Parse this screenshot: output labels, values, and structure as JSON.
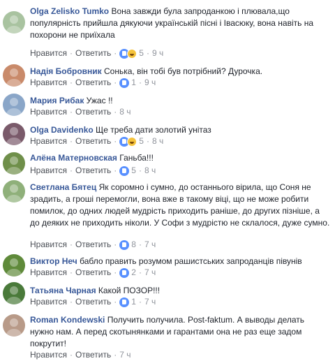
{
  "comments": [
    {
      "author": "Olga Zelisko Tumko",
      "text": "Вона завжди була запроданкою і плювала,що популярність прийшла дякуючи українській пісні і Івасюку, вона навіть на похорони не приїхала",
      "like": "Нравится",
      "reply": "Ответить",
      "reactions": [
        "like",
        "haha"
      ],
      "count": "5",
      "time": "9 ч",
      "avatar_color": "#a9c3a0"
    },
    {
      "author": "Надія Бобровник",
      "text": "Сонька, він тобі був потрібний? Дурочка.",
      "like": "Нравится",
      "reply": "Ответить",
      "reactions": [
        "like"
      ],
      "count": "1",
      "time": "9 ч",
      "avatar_color": "#c98a6a"
    },
    {
      "author": "Мария Рибак",
      "text": "Ужас !!",
      "like": "Нравится",
      "reply": "Ответить",
      "reactions": [],
      "count": "",
      "time": "8 ч",
      "avatar_color": "#8aa6c8"
    },
    {
      "author": "Olga Davidenko",
      "text": "Ще треба дати золотий унітаз",
      "like": "Нравится",
      "reply": "Ответить",
      "reactions": [
        "like",
        "haha"
      ],
      "count": "5",
      "time": "8 ч",
      "avatar_color": "#7a5a6a"
    },
    {
      "author": "Алёна Матерновская",
      "text": "Ганьба!!!",
      "like": "Нравится",
      "reply": "Ответить",
      "reactions": [
        "like"
      ],
      "count": "5",
      "time": "8 ч",
      "avatar_color": "#6f8f4a"
    },
    {
      "author": "Светлана Бятец",
      "text": "Як соромно і сумно, до останнього вірила, що Соня не зрадить, а гроші перемогли, вона вже в такому віці, що не може робити помилок, до одних людей мудрість приходить раніше, до других пізніше, а до деяких не приходить ніколи. У Софи з мудрістю не склалося, дуже сумно.",
      "like": "Нравится",
      "reply": "Ответить",
      "reactions": [
        "like"
      ],
      "count": "8",
      "time": "7 ч",
      "avatar_color": "#8fb07a"
    },
    {
      "author": "Виктор Неч",
      "text": "бабло править розумом рашистських запроданців півунів",
      "like": "Нравится",
      "reply": "Ответить",
      "reactions": [
        "like"
      ],
      "count": "2",
      "time": "7 ч",
      "avatar_color": "#5f8a3a"
    },
    {
      "author": "Татьяна Чарная",
      "text": "Какой ПОЗОР!!!",
      "like": "Нравится",
      "reply": "Ответить",
      "reactions": [
        "like"
      ],
      "count": "1",
      "time": "7 ч",
      "avatar_color": "#4a7a3a"
    },
    {
      "author": "Roman Kondewski",
      "text": "Получить получила. Post-faktum. А выводы делать нужно нам. А перед скотынянками и гарантами она не раз еще задом покрутит!",
      "like": "Нравится",
      "reply": "Ответить",
      "reactions": [],
      "count": "",
      "time": "7 ч",
      "avatar_color": "#b89a88"
    }
  ]
}
